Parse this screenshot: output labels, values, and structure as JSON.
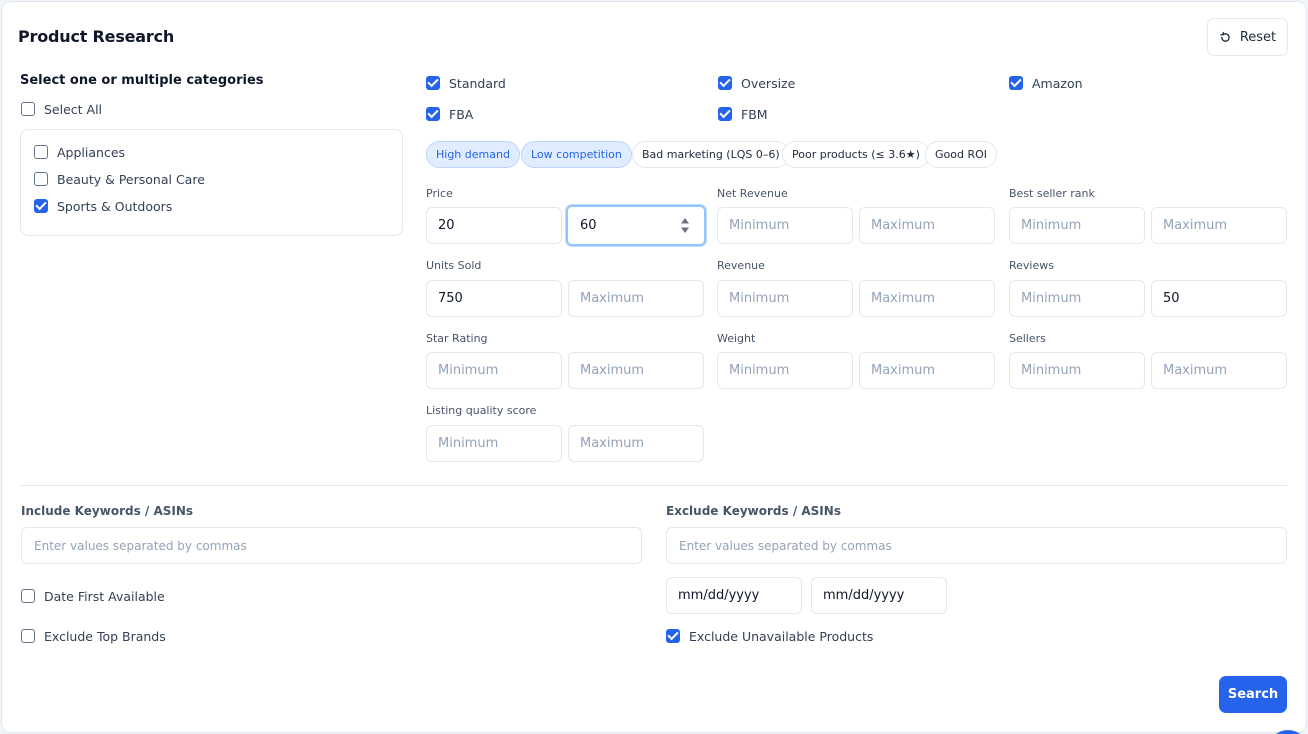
{
  "header": {
    "title": "Product Research",
    "reset_label": "Reset"
  },
  "categories": {
    "heading": "Select one or multiple categories",
    "select_all": "Select All",
    "items": [
      {
        "label": "Appliances",
        "checked": false
      },
      {
        "label": "Beauty & Personal Care",
        "checked": false
      },
      {
        "label": "Sports & Outdoors",
        "checked": true
      }
    ]
  },
  "options": {
    "standard": "Standard",
    "oversize": "Oversize",
    "amazon": "Amazon",
    "fba": "FBA",
    "fbm": "FBM"
  },
  "chips": [
    "High demand",
    "Low competition",
    "Bad marketing (LQS 0–6)",
    "Poor products (≤ 3.6★)",
    "Good ROI"
  ],
  "filters": {
    "placeholder_min": "Minimum",
    "placeholder_max": "Maximum",
    "price": {
      "label": "Price",
      "min": "20",
      "max": "60"
    },
    "net_revenue": {
      "label": "Net Revenue"
    },
    "best_seller_rank": {
      "label": "Best seller rank"
    },
    "units_sold": {
      "label": "Units Sold",
      "min": "750"
    },
    "revenue": {
      "label": "Revenue"
    },
    "reviews": {
      "label": "Reviews",
      "max": "50"
    },
    "star_rating": {
      "label": "Star Rating"
    },
    "weight": {
      "label": "Weight"
    },
    "sellers": {
      "label": "Sellers"
    },
    "listing_quality_score": {
      "label": "Listing quality score"
    }
  },
  "keywords": {
    "include_label": "Include Keywords / ASINs",
    "exclude_label": "Exclude Keywords / ASINs",
    "placeholder": "Enter values separated by commas"
  },
  "extra": {
    "date_first_available": "Date First Available",
    "exclude_top_brands": "Exclude Top Brands",
    "exclude_unavailable": "Exclude Unavailable Products",
    "date_placeholder": "mm/dd/yyyy"
  },
  "actions": {
    "search_label": "Search"
  },
  "colors": {
    "accent": "#2563eb",
    "chip_active_bg": "#e0ecff",
    "border": "#e2e8f0"
  }
}
